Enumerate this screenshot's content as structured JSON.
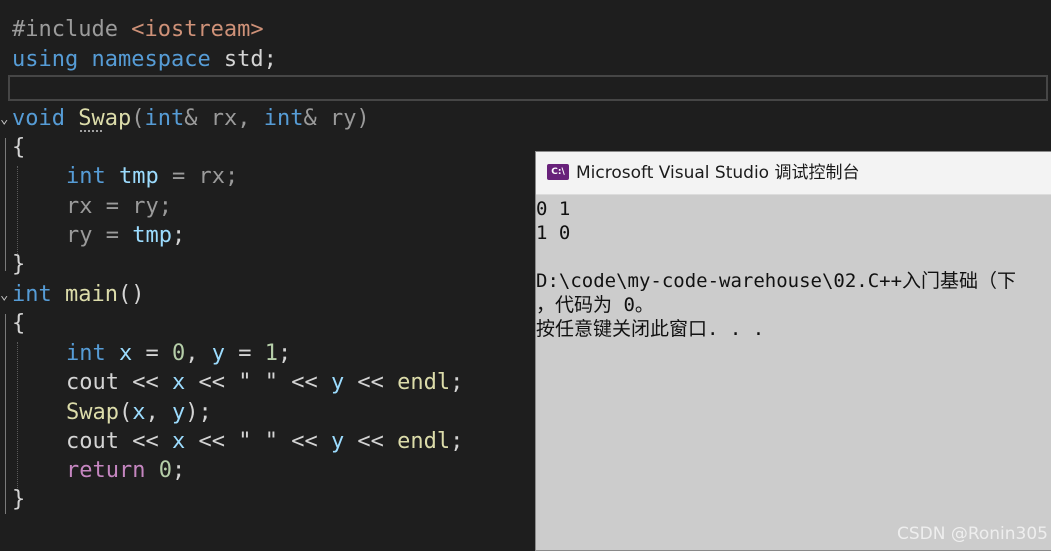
{
  "editor": {
    "lines": {
      "l1_pre": "#include",
      "l1_inc": " <iostream>",
      "l2_kw1": "using",
      "l2_kw2": " namespace",
      "l2_rest": " std;",
      "l4_kw": "void",
      "l4_fn": "Swap",
      "l4_p1": "(",
      "l4_t1": "int",
      "l4_a1": "& rx, ",
      "l4_t2": "int",
      "l4_a2": "& ry)",
      "l5": "{",
      "l6_kw": "int",
      "l6_var": " tmp",
      "l6_rest": " = rx;",
      "l7": "rx = ry;",
      "l8_a": "ry = ",
      "l8_var": "tmp",
      "l8_end": ";",
      "l9": "}",
      "l10_kw": "int",
      "l10_fn": " main",
      "l10_rest": "()",
      "l11": "{",
      "l12_kw": "int",
      "l12_x": " x",
      "l12_eq1": " = ",
      "l12_n0": "0",
      "l12_c": ", ",
      "l12_y": "y",
      "l12_eq2": " = ",
      "l12_n1": "1",
      "l12_end": ";",
      "cout": "cout",
      "op": " << ",
      "x": "x",
      "str": "\" \"",
      "y": "y",
      "endl": "endl",
      "semi": ";",
      "l14_fn": "Swap",
      "l14_a": "(",
      "l14_x": "x",
      "l14_c": ", ",
      "l14_y": "y",
      "l14_end": ");",
      "l16_kw": "return",
      "l16_n": " 0",
      "l16_end": ";",
      "l17": "}"
    }
  },
  "console": {
    "title": "Microsoft Visual Studio 调试控制台",
    "icon_label": "C:\\",
    "output": [
      "0 1",
      "1 0",
      "",
      "D:\\code\\my-code-warehouse\\02.C++入门基础（下",
      "，代码为 0。",
      "按任意键关闭此窗口. . ."
    ]
  },
  "watermark": "CSDN @Ronin305",
  "colors": {
    "editor_bg": "#1e1e1e",
    "keyword": "#569cd6",
    "control_keyword": "#c586c0",
    "function": "#dcdcaa",
    "variable": "#9cdcfe",
    "number": "#b5cea8",
    "string": "#ce9178",
    "console_bg": "#cccccc"
  }
}
